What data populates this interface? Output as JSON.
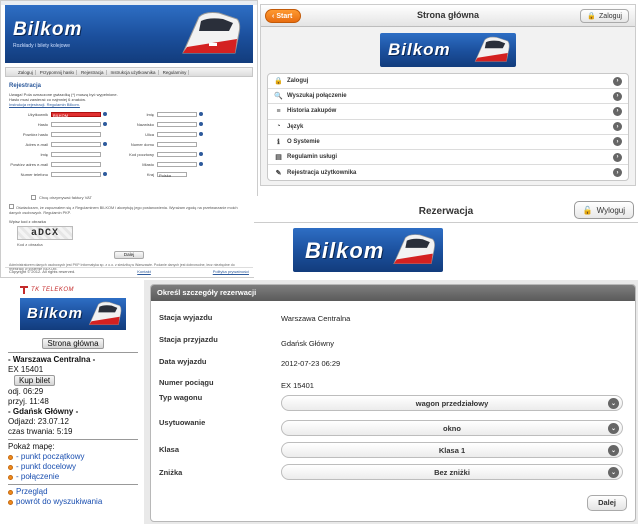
{
  "brand": {
    "logo": "Bilkom",
    "tagline": "Rozkłady i bilety kolejowe"
  },
  "desktop": {
    "nav": [
      "Zaloguj",
      "Przypomnij hasło",
      "Rejestracja",
      "Instrukcja użytkownika",
      "Regulaminy"
    ],
    "heading": "Rejestracja",
    "notes": [
      "Uwaga! Pola oznaczone gwiazdką (*) muszą być wypełnione.",
      "Hasło musi zawierać co najmniej 6 znaków.",
      "Instrukcja rejestracji. Regulamin Bilkom."
    ],
    "fields_left": [
      "Użytkownik",
      "Hasło",
      "Powtórz hasło",
      "Adres e-mail",
      "Imię",
      "Powtórz adres e-mail",
      "Numer telefonu"
    ],
    "first_value": "BILKOM",
    "fields_right": [
      "Imię",
      "Nazwisko",
      "Ulica",
      "Numer domu",
      "Kod pocztowy",
      "Miasto",
      "Kraj"
    ],
    "country_value": "Polska",
    "vat_checkbox": "Chcę otrzymywać faktury VAT",
    "legal": "Oświadczam, że zapoznałem się z Regulaminem BILKOM i akceptuję jego postanowienia. Wyrażam zgodę na przetwarzanie moich danych osobowych. Regulamin PKP.",
    "captcha_label": "Wpisz kod z obrazka",
    "captcha_text": "aDCX",
    "captcha_input": "Kod z obrazka",
    "next_label": "Dalej",
    "fine_print": "Administratorem danych osobowych jest PKP Informatyka sp. z o.o. z siedzibą w Warszawie. Podanie danych jest dobrowolne, lecz niezbędne do rejestracji w systemie BILKOM.",
    "footer_left": "Copyright © 2012. All rights reserved.",
    "footer_mid": "Kontakt",
    "footer_right": "Polityka prywatności"
  },
  "mobile_start": {
    "back_label": "Start",
    "title": "Strona główna",
    "login_label": "Zaloguj",
    "items": [
      {
        "label": "Zaloguj",
        "icon": "lock-icon",
        "glyph": "🔒"
      },
      {
        "label": "Wyszukaj połączenie",
        "icon": "search-icon",
        "glyph": "🔍"
      },
      {
        "label": "Historia zakupów",
        "icon": "list-icon",
        "glyph": "≡"
      },
      {
        "label": "Język",
        "icon": "globe-icon",
        "glyph": "◔"
      },
      {
        "label": "O Systemie",
        "icon": "info-icon",
        "glyph": "ℹ"
      },
      {
        "label": "Regulamin usługi",
        "icon": "document-icon",
        "glyph": "▤"
      },
      {
        "label": "Rejestracja użytkownika",
        "icon": "user-icon",
        "glyph": "✎"
      }
    ]
  },
  "reservation_header": {
    "title": "Rezerwacja",
    "logout_label": "Wyloguj"
  },
  "mobile_lite": {
    "operator": "TK TELEKOM",
    "home_label": "Strona główna",
    "from_line": "- Warszawa Centralna -",
    "train": "EX 15401",
    "buy_label": "Kup bilet",
    "dep": "odj. 06:29",
    "arr": "przyj. 11:48",
    "to_line": "- Gdańsk Główny -",
    "date": "Odjazd: 23.07.12",
    "duration": "czas trwania: 5:19",
    "map_label": "Pokaż mapę:",
    "map_links": [
      "- punkt początkowy",
      "- punkt docelowy",
      "- połączenie"
    ],
    "overview": "Przegląd",
    "back_search": "powrót do wyszukiwania"
  },
  "reservation_detail": {
    "heading": "Określ szczegóły rezerwacji",
    "rows": [
      {
        "label": "Stacja wyjazdu",
        "value": "Warszawa Centralna"
      },
      {
        "label": "Stacja przyjazdu",
        "value": "Gdańsk Główny"
      },
      {
        "label": "Data wyjazdu",
        "value": "2012-07-23 06:29"
      },
      {
        "label": "Numer pociągu",
        "value": "EX 15401"
      }
    ],
    "selects": [
      {
        "label": "Typ wagonu",
        "value": "wagon przedziałowy"
      },
      {
        "label": "Usytuowanie",
        "value": "okno"
      },
      {
        "label": "Klasa",
        "value": "Klasa 1"
      },
      {
        "label": "Zniżka",
        "value": "Bez zniżki"
      }
    ],
    "next_label": "Dalej"
  },
  "colors": {
    "brand_blue": "#1b4f9c",
    "accent_orange": "#e86d10",
    "error_red": "#e03030"
  }
}
